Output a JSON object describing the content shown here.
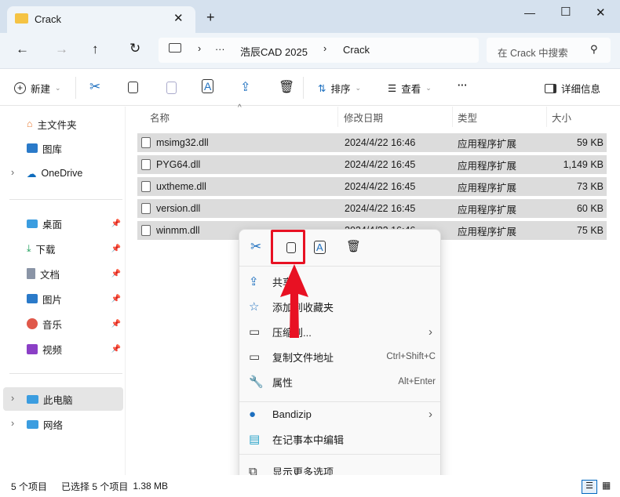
{
  "window": {
    "tab_title": "Crack",
    "new_tab": "+",
    "controls": [
      "—",
      "☐",
      "✕"
    ]
  },
  "address": {
    "breadcrumb": [
      "浩辰CAD 2025",
      "Crack"
    ],
    "ellipsis": "···",
    "search_placeholder": "在 Crack 中搜索"
  },
  "toolbar": {
    "new_label": "新建",
    "sort_label": "排序",
    "view_label": "查看",
    "more": "···",
    "details_label": "详细信息"
  },
  "sidebar": {
    "items": [
      {
        "label": "主文件夹",
        "icon": "home-icon"
      },
      {
        "label": "图库",
        "icon": "gallery-icon"
      },
      {
        "label": "OneDrive",
        "icon": "cloud-icon"
      },
      {
        "label": "桌面",
        "icon": "desktop-icon",
        "pinned": true
      },
      {
        "label": "下载",
        "icon": "download-icon",
        "pinned": true
      },
      {
        "label": "文档",
        "icon": "document-icon",
        "pinned": true
      },
      {
        "label": "图片",
        "icon": "picture-icon",
        "pinned": true
      },
      {
        "label": "音乐",
        "icon": "music-icon",
        "pinned": true
      },
      {
        "label": "视频",
        "icon": "video-icon",
        "pinned": true
      },
      {
        "label": "此电脑",
        "icon": "pc-icon",
        "selected": true
      },
      {
        "label": "网络",
        "icon": "network-icon"
      }
    ]
  },
  "columns": [
    "名称",
    "修改日期",
    "类型",
    "大小"
  ],
  "files": [
    {
      "name": "msimg32.dll",
      "date": "2024/4/22 16:46",
      "type": "应用程序扩展",
      "size": "59 KB"
    },
    {
      "name": "PYG64.dll",
      "date": "2024/4/22 16:45",
      "type": "应用程序扩展",
      "size": "1,149 KB"
    },
    {
      "name": "uxtheme.dll",
      "date": "2024/4/22 16:45",
      "type": "应用程序扩展",
      "size": "73 KB"
    },
    {
      "name": "version.dll",
      "date": "2024/4/22 16:45",
      "type": "应用程序扩展",
      "size": "60 KB"
    },
    {
      "name": "winmm.dll",
      "date": "2024/4/22 16:46",
      "type": "应用程序扩展",
      "size": "75 KB"
    }
  ],
  "context_menu": {
    "items": [
      {
        "label": "共享",
        "icon": "share-icon"
      },
      {
        "label": "添加到收藏夹",
        "icon": "star-icon"
      },
      {
        "label": "压缩到...",
        "icon": "zip-folder-icon",
        "submenu": true
      },
      {
        "label": "复制文件地址",
        "icon": "path-icon",
        "shortcut": "Ctrl+Shift+C"
      },
      {
        "label": "属性",
        "icon": "wrench-icon",
        "shortcut": "Alt+Enter"
      },
      {
        "label": "Bandizip",
        "icon": "bandizip-icon",
        "submenu": true
      },
      {
        "label": "在记事本中编辑",
        "icon": "notepad-icon"
      },
      {
        "label": "显示更多选项",
        "icon": "more-options-icon"
      }
    ]
  },
  "status": {
    "count": "5 个项目",
    "selected": "已选择 5 个项目",
    "size": "1.38 MB"
  },
  "colors": {
    "highlight": "#e81123",
    "accent": "#0067c0",
    "selection": "#dcdcdc"
  }
}
